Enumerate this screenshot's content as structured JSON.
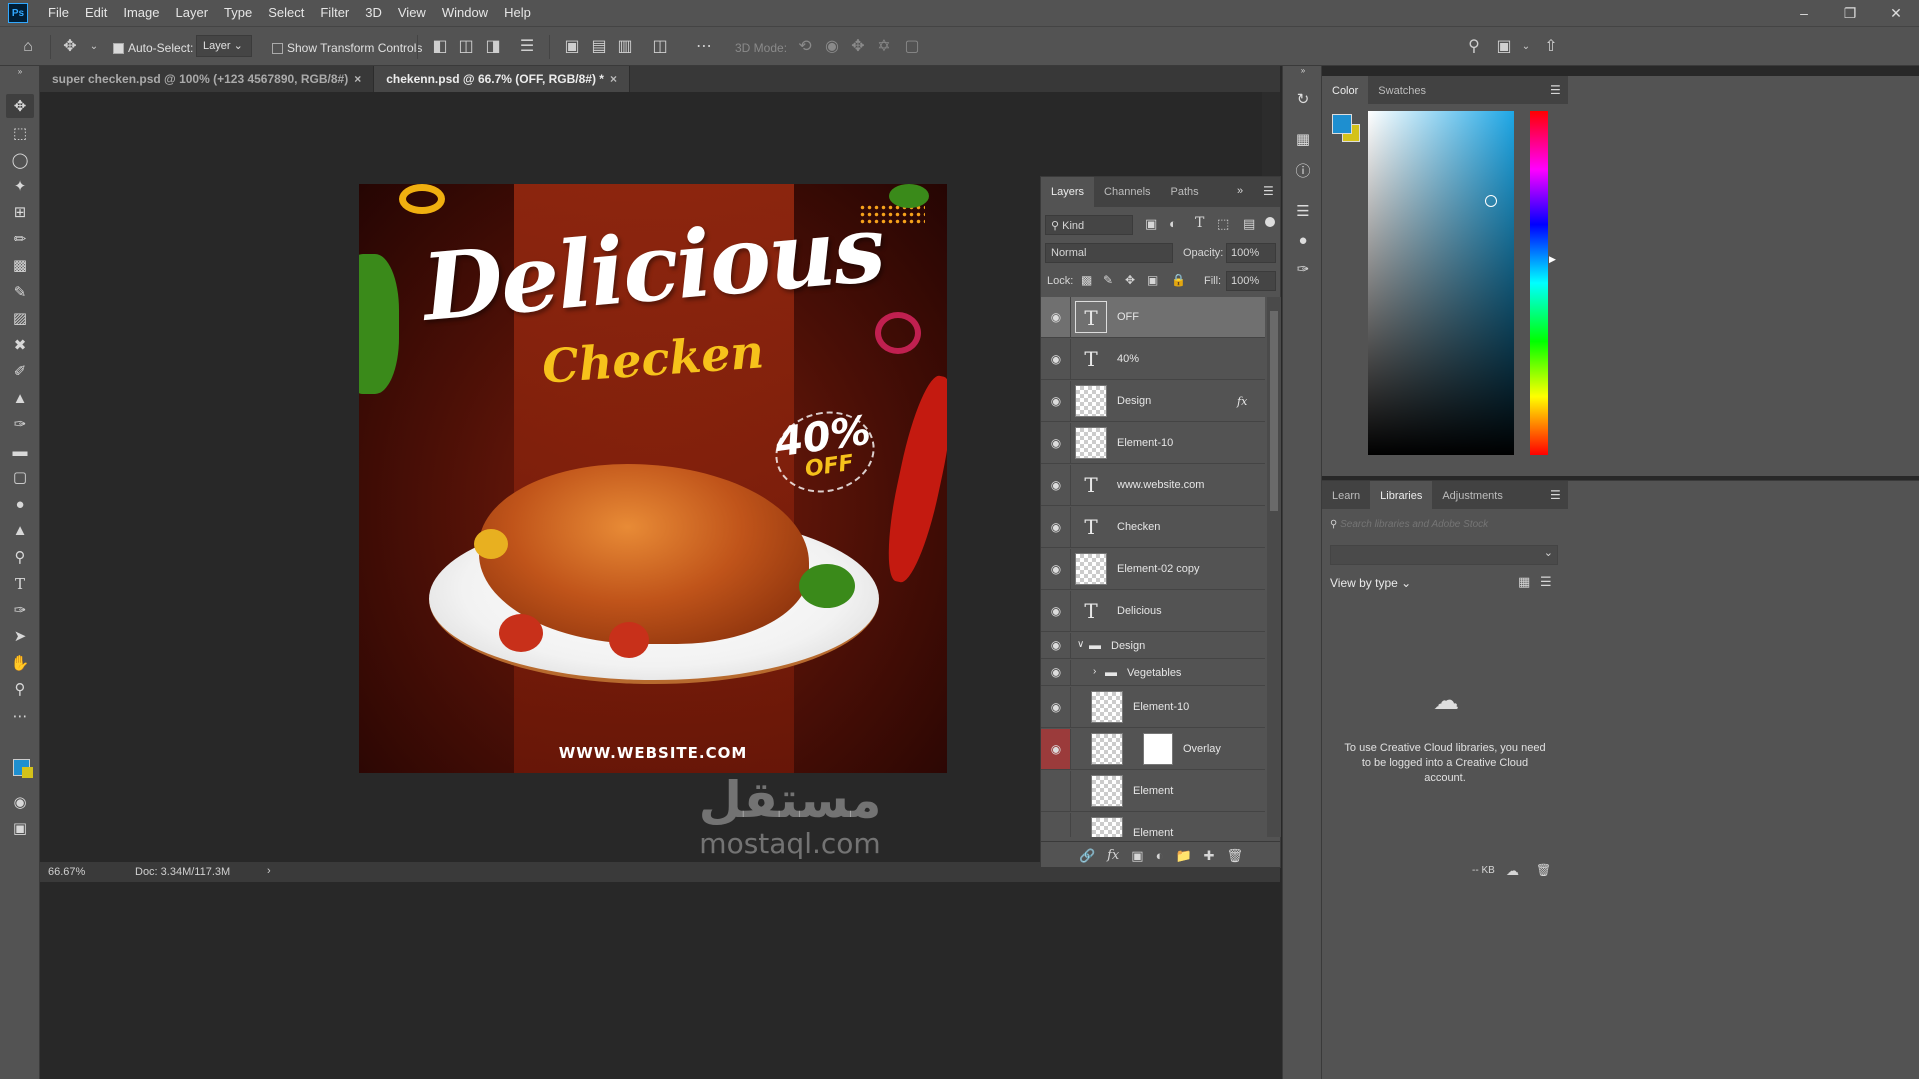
{
  "app": {
    "logo": "Ps"
  },
  "menu": [
    "File",
    "Edit",
    "Image",
    "Layer",
    "Type",
    "Select",
    "Filter",
    "3D",
    "View",
    "Window",
    "Help"
  ],
  "window_controls": {
    "minimize": "–",
    "restore": "❐",
    "close": "✕"
  },
  "options": {
    "auto_select_label": "Auto-Select:",
    "auto_select_checked": true,
    "auto_select_target": "Layer",
    "show_transform_label": "Show Transform Controls",
    "mode_3d_label": "3D Mode:"
  },
  "doc_tabs": [
    {
      "title": "super checken.psd @ 100% (+123 4567890, RGB/8#)",
      "close": "×",
      "active": false
    },
    {
      "title": "chekenn.psd @ 66.7% (OFF, RGB/8#) *",
      "close": "×",
      "active": true
    }
  ],
  "artwork": {
    "title": "Delicious",
    "subtitle": "Checken",
    "percent": "40%",
    "off": "OFF",
    "website": "WWW.WEBSITE.COM"
  },
  "watermark": {
    "arabic": "مستقل",
    "latin": "mostaql.com"
  },
  "status": {
    "zoom": "66.67%",
    "doc": "Doc: 3.34M/117.3M",
    "arrow": "›"
  },
  "layers_panel": {
    "tabs": [
      "Layers",
      "Channels",
      "Paths"
    ],
    "kind_label": "Kind",
    "blend_mode": "Normal",
    "opacity_label": "Opacity:",
    "opacity": "100%",
    "lock_label": "Lock:",
    "fill_label": "Fill:",
    "fill": "100%",
    "layers": [
      {
        "name": "OFF",
        "type": "text",
        "visible": true,
        "selected": true
      },
      {
        "name": "40%",
        "type": "text",
        "visible": true
      },
      {
        "name": "Design",
        "type": "smart",
        "visible": true,
        "fx": "fx"
      },
      {
        "name": "Element-10",
        "type": "smart",
        "visible": true
      },
      {
        "name": "www.website.com",
        "type": "text",
        "visible": true
      },
      {
        "name": "Checken",
        "type": "text",
        "visible": true
      },
      {
        "name": "Element-02 copy",
        "type": "smart",
        "visible": true
      },
      {
        "name": "Delicious",
        "type": "text",
        "visible": true
      },
      {
        "name": "Design",
        "type": "group",
        "visible": true,
        "expanded": true
      },
      {
        "name": "Vegetables",
        "type": "group",
        "visible": true,
        "indent": 1
      },
      {
        "name": "Element-10",
        "type": "smart",
        "visible": true,
        "indent": 1
      },
      {
        "name": "Overlay",
        "type": "adjust",
        "visible": true,
        "indent": 1,
        "highlight_eye": true
      },
      {
        "name": "Element",
        "type": "smart",
        "visible": false,
        "indent": 1
      },
      {
        "name": "Element",
        "type": "smart",
        "visible": false,
        "indent": 1
      }
    ]
  },
  "color_panel": {
    "tabs": [
      "Color",
      "Swatches"
    ],
    "fg": "#1e8fd0",
    "bg": "#d4c21a"
  },
  "libraries_panel": {
    "tabs": [
      "Learn",
      "Libraries",
      "Adjustments"
    ],
    "search_placeholder": "Search libraries and Adobe Stock",
    "view_by": "View by type",
    "message": "To use Creative Cloud libraries, you need to be logged into a Creative Cloud account.",
    "kb": "-- KB"
  }
}
